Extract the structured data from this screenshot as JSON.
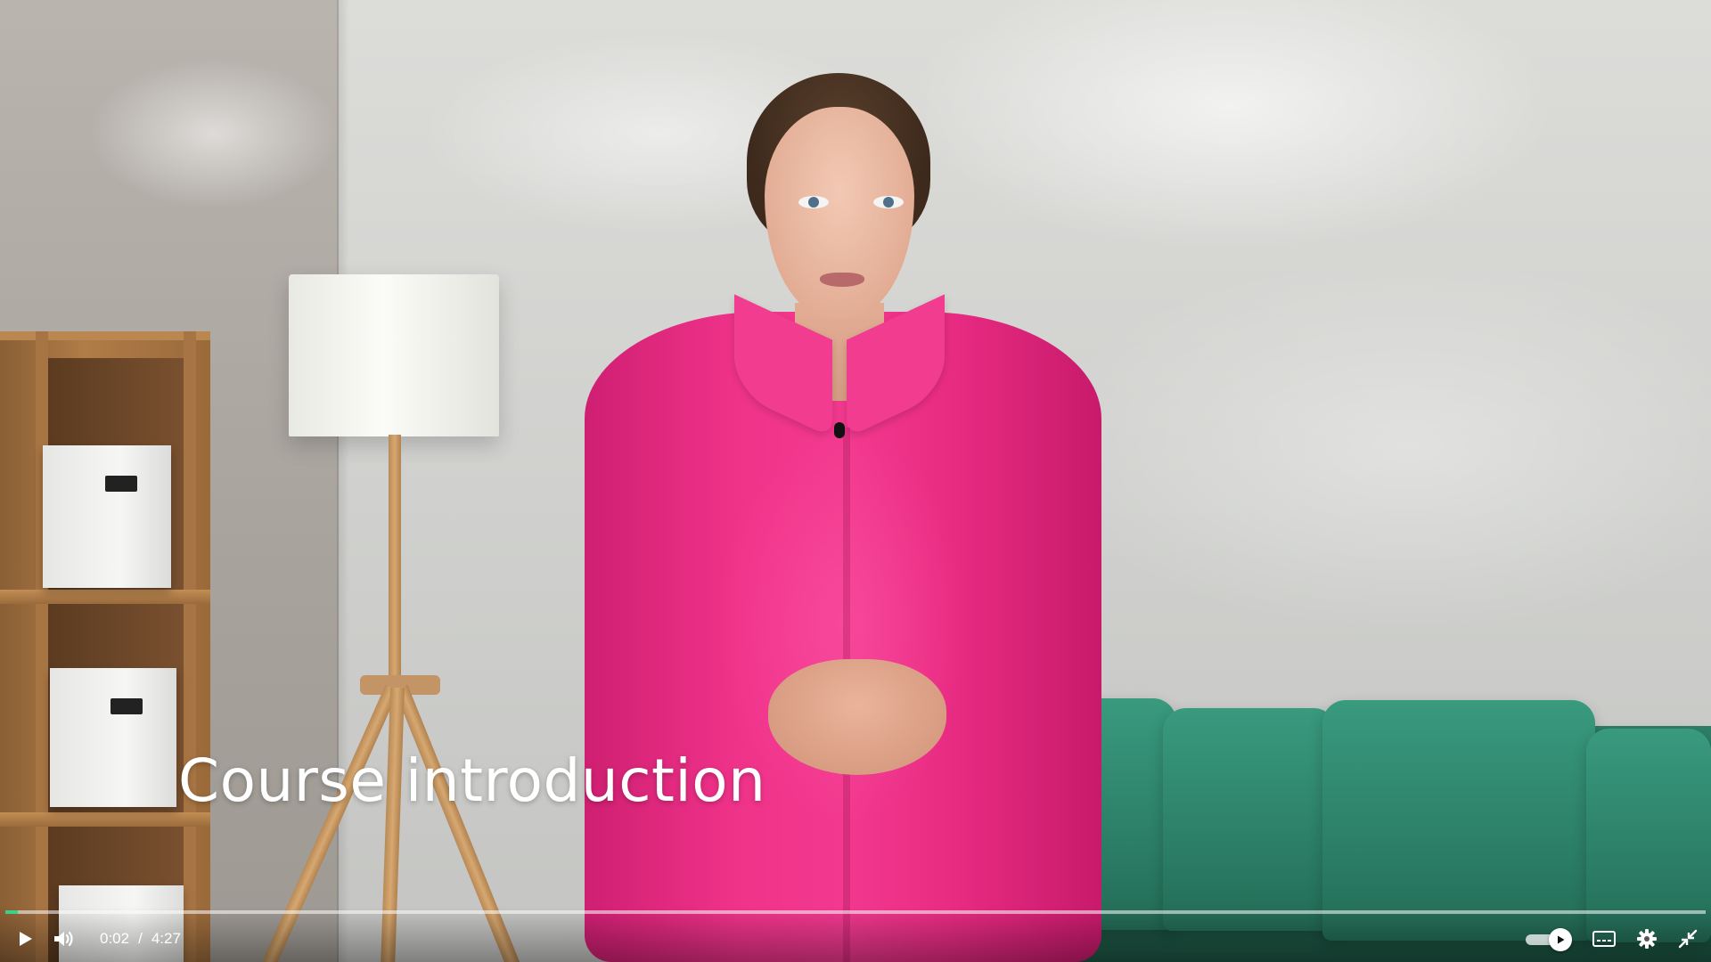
{
  "video": {
    "caption": "Course introduction"
  },
  "controls": {
    "current_time": "0:02",
    "separator": "/",
    "duration": "4:27",
    "progress_fraction": 0.0075,
    "autoplay_on": true,
    "icons": {
      "play": "play-icon",
      "volume": "volume-icon",
      "autoplay": "autoplay-toggle-icon",
      "captions": "captions-icon",
      "settings": "gear-icon",
      "fullscreen": "exit-fullscreen-icon"
    },
    "accent_color": "#3ecf8e"
  }
}
